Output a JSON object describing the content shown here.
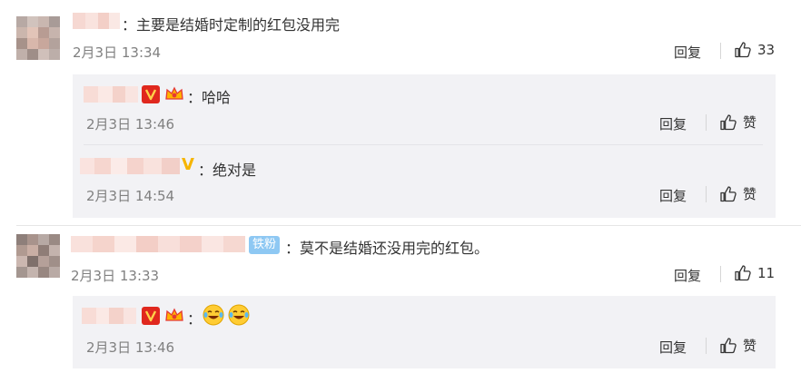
{
  "comments": [
    {
      "text": "：主要是结婚时定制的红包没用完",
      "time": "2月3日 13:34",
      "reply_label": "回复",
      "likes": "33",
      "replies": [
        {
          "text": "：哈哈",
          "time": "2月3日 13:46",
          "reply_label": "回复",
          "like_label": "赞"
        },
        {
          "text": "：绝对是",
          "time": "2月3日 14:54",
          "reply_label": "回复",
          "like_label": "赞"
        }
      ]
    },
    {
      "badge": "铁粉",
      "text": "：莫不是结婚还没用完的红包。",
      "time": "2月3日 13:33",
      "reply_label": "回复",
      "likes": "11",
      "replies": [
        {
          "text": "：",
          "time": "2月3日 13:46",
          "reply_label": "回复",
          "like_label": "赞"
        }
      ]
    }
  ],
  "icons": {
    "like": "thumbs-up-icon",
    "vip": "vip-v-badge-icon",
    "crown": "crown-member-icon",
    "emoji": "laughing-tears-emoji-icon"
  },
  "colors": {
    "vip_red": "#e0281e",
    "tiefen_blue": "#8ec8f3",
    "meta_gray": "#808080",
    "sub_bg": "#f2f2f5"
  }
}
